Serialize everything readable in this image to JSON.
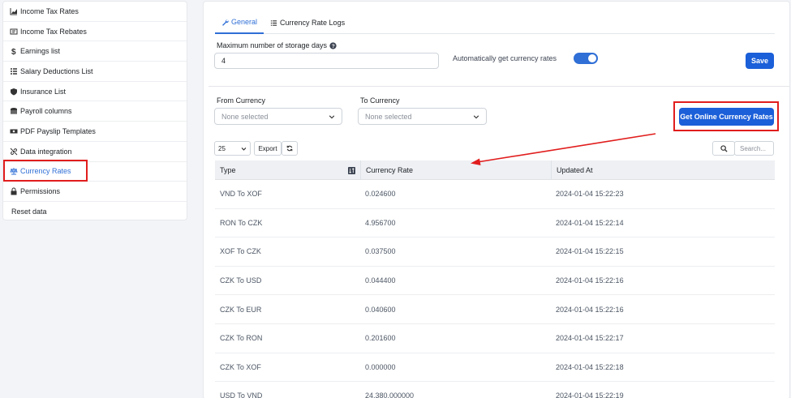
{
  "sidebar": {
    "items": [
      {
        "label": "Income Tax Rates",
        "icon": "chart-area-icon"
      },
      {
        "label": "Income Tax Rebates",
        "icon": "receipt-icon"
      },
      {
        "label": "Earnings list",
        "icon": "dollar-icon"
      },
      {
        "label": "Salary Deductions List",
        "icon": "list-icon"
      },
      {
        "label": "Insurance List",
        "icon": "shield-icon"
      },
      {
        "label": "Payroll columns",
        "icon": "database-icon"
      },
      {
        "label": "PDF Payslip Templates",
        "icon": "money-bill-icon"
      },
      {
        "label": "Data integration",
        "icon": "link-icon"
      },
      {
        "label": "Currency Rates",
        "icon": "scale-icon",
        "active": true
      },
      {
        "label": "Permissions",
        "icon": "lock-icon"
      },
      {
        "label": "Reset data",
        "icon": ""
      }
    ]
  },
  "tabs": [
    {
      "label": "General",
      "icon": "wrench-icon",
      "active": true
    },
    {
      "label": "Currency Rate Logs",
      "icon": "list-icon"
    }
  ],
  "settings": {
    "storage_days_label": "Maximum number of storage days",
    "storage_days_value": "4",
    "auto_label": "Automatically get currency rates",
    "auto_enabled": true,
    "save_label": "Save"
  },
  "filters": {
    "from_label": "From Currency",
    "from_value": "None selected",
    "to_label": "To Currency",
    "to_value": "None selected",
    "get_rates_label": "Get Online Currency Rates"
  },
  "table_controls": {
    "page_size": "25",
    "export_label": "Export",
    "search_placeholder": "Search..."
  },
  "table": {
    "headers": [
      "Type",
      "Currency Rate",
      "Updated At"
    ],
    "rows": [
      [
        "VND To XOF",
        "0.024600",
        "2024-01-04 15:22:23"
      ],
      [
        "RON To CZK",
        "4.956700",
        "2024-01-04 15:22:14"
      ],
      [
        "XOF To CZK",
        "0.037500",
        "2024-01-04 15:22:15"
      ],
      [
        "CZK To USD",
        "0.044400",
        "2024-01-04 15:22:16"
      ],
      [
        "CZK To EUR",
        "0.040600",
        "2024-01-04 15:22:16"
      ],
      [
        "CZK To RON",
        "0.201600",
        "2024-01-04 15:22:17"
      ],
      [
        "CZK To XOF",
        "0.000000",
        "2024-01-04 15:22:18"
      ],
      [
        "USD To VND",
        "24,380.000000",
        "2024-01-04 15:22:19"
      ]
    ]
  },
  "colors": {
    "accent": "#1b5fd9",
    "highlight": "#e11d1d"
  }
}
